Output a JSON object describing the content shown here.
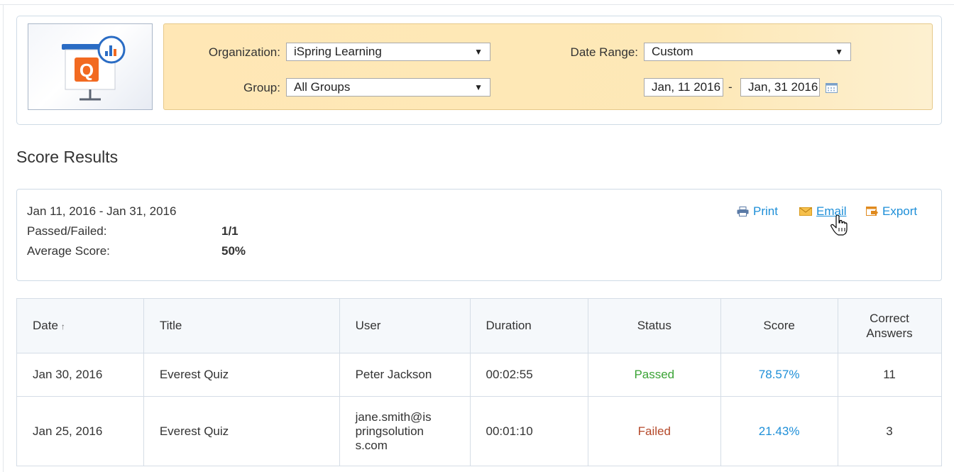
{
  "filters": {
    "organization_label": "Organization:",
    "organization_value": "iSpring Learning",
    "group_label": "Group:",
    "group_value": "All Groups",
    "date_range_label": "Date Range:",
    "date_range_value": "Custom",
    "date_from": "Jan, 11 2016",
    "date_to": "Jan, 31 2016",
    "date_separator": "-"
  },
  "logo": {
    "letter": "Q"
  },
  "title": "Score Results",
  "summary": {
    "date_range": "Jan 11, 2016 - Jan 31, 2016",
    "passed_failed_label": "Passed/Failed:",
    "passed_failed_value": "1/1",
    "average_score_label": "Average Score:",
    "average_score_value": "50%"
  },
  "actions": {
    "print": "Print",
    "email": "Email",
    "export": "Export"
  },
  "table": {
    "headers": {
      "date": "Date",
      "title": "Title",
      "user": "User",
      "duration": "Duration",
      "status": "Status",
      "score": "Score",
      "correct_line1": "Correct",
      "correct_line2": "Answers"
    },
    "sort_indicator": "↑",
    "rows": [
      {
        "date": "Jan 30, 2016",
        "title": "Everest Quiz",
        "user": "Peter Jackson",
        "duration": "00:02:55",
        "status": "Passed",
        "score": "78.57%",
        "correct": "11"
      },
      {
        "date": "Jan 25, 2016",
        "title": "Everest Quiz",
        "user": "jane.smith@ispringsolutions.com",
        "duration": "00:01:10",
        "status": "Failed",
        "score": "21.43%",
        "correct": "3"
      }
    ]
  },
  "colors": {
    "link": "#1e8fd8",
    "passed": "#3aa335",
    "failed": "#b5492a",
    "filter_bg": "#fde8b7"
  }
}
